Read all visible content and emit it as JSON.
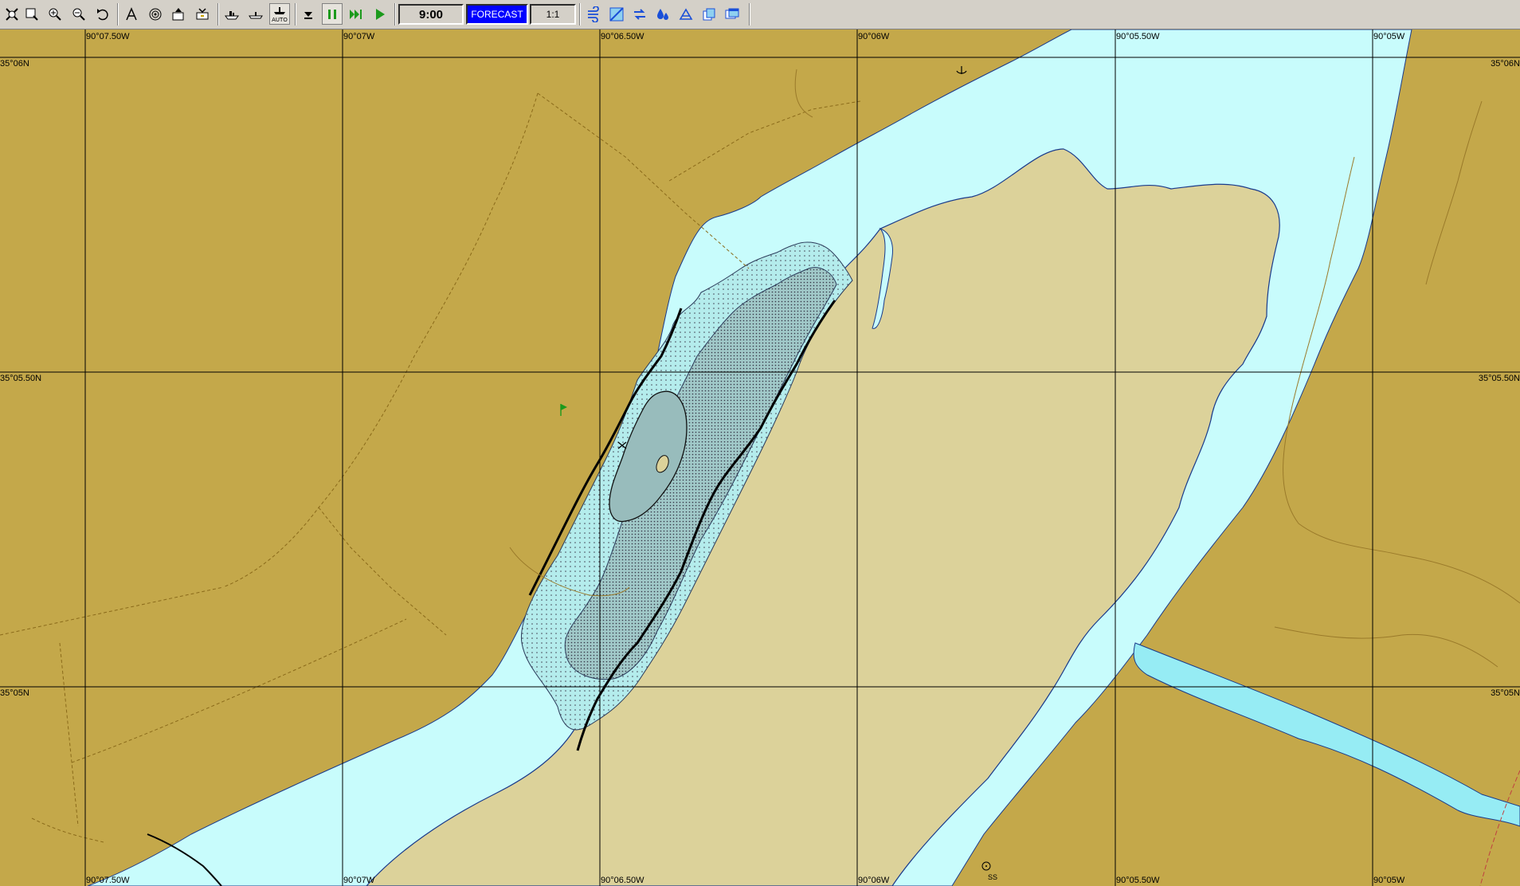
{
  "toolbar": {
    "buttons": [
      {
        "name": "select-tool-icon"
      },
      {
        "name": "zoom-box-icon"
      },
      {
        "name": "zoom-in-icon"
      },
      {
        "name": "zoom-out-icon"
      },
      {
        "name": "undo-view-icon"
      },
      {
        "name": "measure-tool-icon"
      },
      {
        "name": "target-icon"
      },
      {
        "name": "export-icon"
      },
      {
        "name": "print-icon"
      },
      {
        "name": "vessel-icon"
      },
      {
        "name": "boat-icon"
      },
      {
        "name": "auto-icon",
        "label": "AUTO"
      },
      {
        "name": "dropdown-icon"
      },
      {
        "name": "pause-icon"
      },
      {
        "name": "fast-forward-icon"
      },
      {
        "name": "play-icon"
      },
      {
        "name": "wind-icon"
      },
      {
        "name": "grid-map-icon"
      },
      {
        "name": "current-icon"
      },
      {
        "name": "spill-icon"
      },
      {
        "name": "weathering-icon"
      },
      {
        "name": "layers-icon"
      },
      {
        "name": "window-icon"
      }
    ],
    "time": "9:00",
    "forecast": "FORECAST",
    "scale": "1:1"
  },
  "chart": {
    "colors": {
      "land": "#c4a84a",
      "water": "#c8fcfc",
      "bar": "#dcd29a",
      "channel": "#96ecf4",
      "spill_light": "#b4ecec",
      "spill_dark": "#a0c8c8",
      "gridline": "#000000"
    },
    "longitude_labels": [
      "90°07.50W",
      "90°07W",
      "90°06.50W",
      "90°06W",
      "90°05.50W",
      "90°05W"
    ],
    "latitude_labels": [
      "35°06N",
      "35°05.50N",
      "35°05N"
    ],
    "markers": [
      {
        "name": "flag-marker-icon"
      },
      {
        "name": "anchor-marker-icon"
      },
      {
        "name": "ss-marker-icon",
        "label": "SS"
      }
    ]
  }
}
